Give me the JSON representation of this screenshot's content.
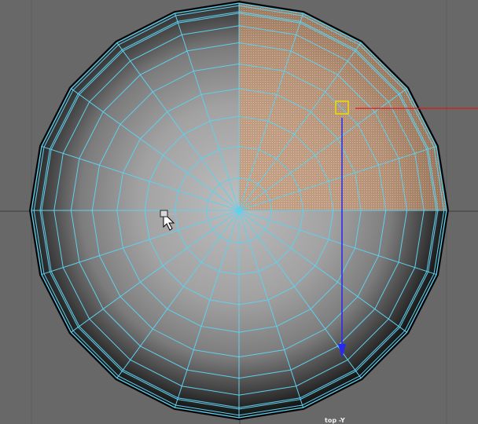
{
  "viewport": {
    "camera_label": "top -Y",
    "background_color": "#686868",
    "wireframe_color": "#5fd0ef",
    "selection_color": "#e8a06a",
    "axis_colors": {
      "x": "#e01818",
      "y": "#2828f0",
      "z": "#e8e000"
    }
  },
  "mesh": {
    "type": "polySphere",
    "subdivisions_axis": 20,
    "subdivisions_height": 20,
    "selected_faces": "quadrant-top-right"
  },
  "tool": {
    "name": "move-tool",
    "cursor_icon": "select-cursor-icon"
  }
}
